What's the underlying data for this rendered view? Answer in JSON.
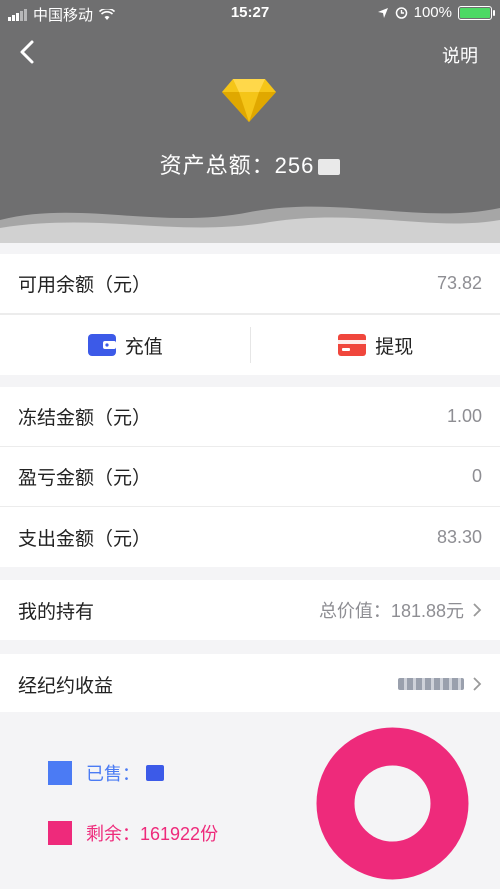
{
  "status_bar": {
    "carrier": "中国移动",
    "time": "15:27",
    "battery": "100%"
  },
  "header": {
    "help_label": "说明",
    "total_label": "资产总额：",
    "total_value": "256"
  },
  "balance": {
    "label": "可用余额（元）",
    "value": "73.82"
  },
  "actions": {
    "recharge": "充值",
    "withdraw": "提现"
  },
  "details": [
    {
      "label": "冻结金额（元）",
      "value": "1.00"
    },
    {
      "label": "盈亏金额（元）",
      "value": "0"
    },
    {
      "label": "支出金额（元）",
      "value": "83.30"
    }
  ],
  "holdings": {
    "label": "我的持有",
    "value": "总价值：181.88元"
  },
  "brokerage": {
    "label": "经纪约收益"
  },
  "legend": {
    "sold_label": "已售：",
    "remaining_label": "剩余：161922份",
    "sold_color": "#4b7bf4",
    "remaining_color": "#ee2a7b"
  },
  "colors": {
    "header_bg": "#6f6f70",
    "accent_blue": "#3c5ae8",
    "accent_red": "#f0463c"
  }
}
